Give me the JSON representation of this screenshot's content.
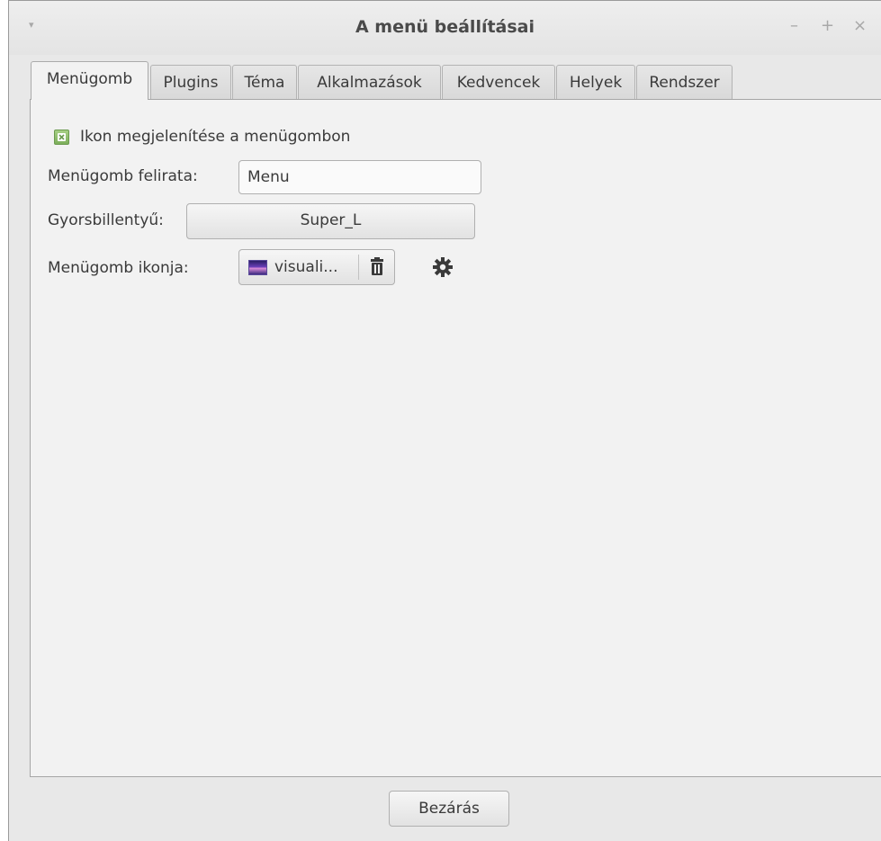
{
  "window": {
    "title": "A menü beállításai",
    "menu_glyph": "▾",
    "minimize_glyph": "–",
    "maximize_glyph": "+",
    "close_glyph": "×"
  },
  "tabs": [
    {
      "label": "Menügomb",
      "active": true
    },
    {
      "label": "Plugins",
      "active": false
    },
    {
      "label": "Téma",
      "active": false
    },
    {
      "label": "Alkalmazások",
      "active": false
    },
    {
      "label": "Kedvencek",
      "active": false
    },
    {
      "label": "Helyek",
      "active": false
    },
    {
      "label": "Rendszer",
      "active": false
    }
  ],
  "menubutton": {
    "show_icon_label": "Ikon megjelenítése a menügombon",
    "show_icon_checked": true,
    "caption_label": "Menügomb felirata:",
    "caption_value": "Menu",
    "hotkey_label": "Gyorsbillentyű:",
    "hotkey_value": "Super_L",
    "icon_label": "Menügomb ikonja:",
    "icon_file": "visuali...",
    "icons": {
      "checkbox": "checkmark-icon",
      "thumbnail": "image-thumbnail-icon",
      "clear": "trash-icon",
      "settings": "gear-icon"
    }
  },
  "footer": {
    "close_label": "Bezárás"
  },
  "colors": {
    "window_bg": "#e8e8e8",
    "panel_bg": "#f2f2f2",
    "checkbox_green": "#7daf5b"
  }
}
